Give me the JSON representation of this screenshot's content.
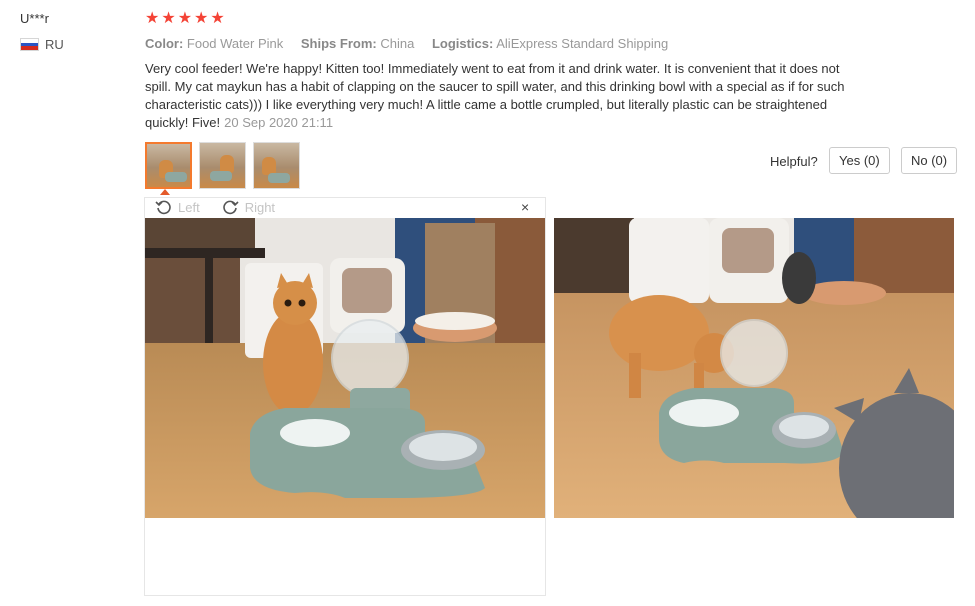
{
  "reviewer": {
    "name": "U***r",
    "country": "RU"
  },
  "rating": {
    "stars": 5,
    "max": 5
  },
  "attributes": [
    {
      "key": "Color:",
      "value": "Food Water Pink"
    },
    {
      "key": "Ships From:",
      "value": "China"
    },
    {
      "key": "Logistics:",
      "value": "AliExpress Standard Shipping"
    }
  ],
  "review": {
    "text": "Very cool feeder! We're happy! Kitten too! Immediately went to eat from it and drink water. It is convenient that it does not spill. My cat maykun has a habit of clapping on the saucer to spill water, and this drinking bowl with a special as if for such characteristic cats))) I like everything very much! A little came a bottle crumpled, but literally plastic can be straightened quickly! Five!",
    "date": "20 Sep 2020 21:11"
  },
  "helpful": {
    "label": "Helpful?",
    "yes": "Yes (0)",
    "no": "No (0)"
  },
  "viewer": {
    "left_label": "Left",
    "right_label": "Right",
    "close": "×"
  },
  "thumbnails": {
    "count": 3,
    "active_index": 0
  },
  "colors": {
    "star": "#f44336",
    "accent": "#f47a2e",
    "muted": "#999999"
  }
}
